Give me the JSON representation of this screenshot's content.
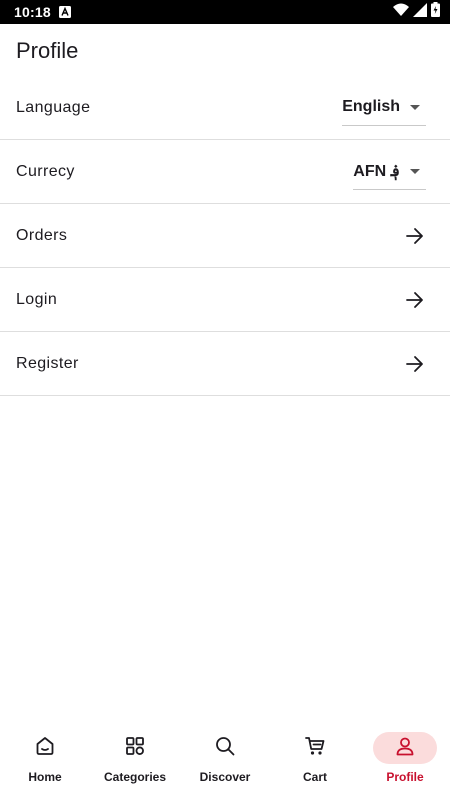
{
  "status_bar": {
    "time": "10:18"
  },
  "page": {
    "title": "Profile"
  },
  "settings": {
    "language": {
      "label": "Language",
      "value": "English"
    },
    "currency": {
      "label": "Currecy",
      "value": "AFN ؋"
    },
    "orders": {
      "label": "Orders"
    },
    "login": {
      "label": "Login"
    },
    "register": {
      "label": "Register"
    }
  },
  "bottom_nav": {
    "active": "Profile",
    "accent_color": "#c8102e",
    "items": [
      {
        "label": "Home",
        "icon": "home-icon"
      },
      {
        "label": "Categories",
        "icon": "grid-icon"
      },
      {
        "label": "Discover",
        "icon": "search-icon"
      },
      {
        "label": "Cart",
        "icon": "cart-icon"
      },
      {
        "label": "Profile",
        "icon": "person-icon"
      }
    ]
  }
}
